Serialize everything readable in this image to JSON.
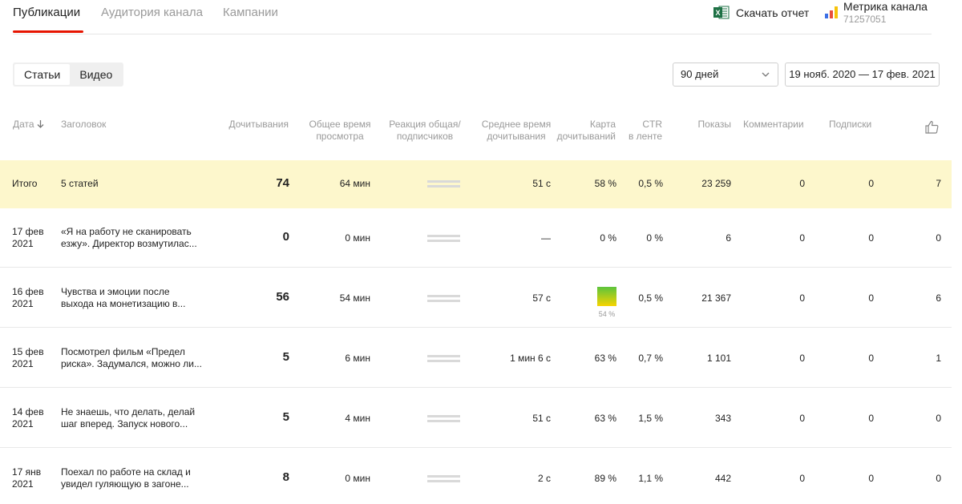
{
  "nav": {
    "tabs": [
      "Публикации",
      "Аудитория канала",
      "Кампании"
    ],
    "download_label": "Скачать отчет",
    "metrika_title": "Метрика канала",
    "metrika_id": "71257051"
  },
  "filters": {
    "segments": [
      "Статьи",
      "Видео"
    ],
    "period": "90 дней",
    "date_range": "19 нояб. 2020 — 17 фев. 2021"
  },
  "table": {
    "headers": {
      "date": "Дата",
      "title": "Заголовок",
      "reads": "Дочитывания",
      "total_time": [
        "Общее время",
        "просмотра"
      ],
      "reaction": [
        "Реакция общая/",
        "подписчиков"
      ],
      "avg_time": [
        "Среднее время",
        "дочитывания"
      ],
      "map": [
        "Карта",
        "дочитываний"
      ],
      "ctr": [
        "CTR",
        "в ленте"
      ],
      "shows": "Показы",
      "comments": "Комментарии",
      "subs": "Подписки"
    },
    "total": {
      "label": "Итого",
      "title": "5 статей",
      "reads": "74",
      "total_time": "64 мин",
      "avg_time": "51 с",
      "map": "58 %",
      "ctr": "0,5 %",
      "shows": "23 259",
      "comments": "0",
      "subs": "0",
      "likes": "7"
    },
    "rows": [
      {
        "date": [
          "17 фев",
          "2021"
        ],
        "title": [
          "«Я на работу не сканировать",
          "езжу». Директор возмутилас..."
        ],
        "reads": "0",
        "total_time": "0 мин",
        "avg_time": "—",
        "map": "0 %",
        "ctr": "0 %",
        "shows": "6",
        "comments": "0",
        "subs": "0",
        "likes": "0"
      },
      {
        "date": [
          "16 фев",
          "2021"
        ],
        "title": [
          "Чувства и эмоции после",
          "выхода на монетизацию в..."
        ],
        "reads": "56",
        "total_time": "54 мин",
        "avg_time": "57 с",
        "map": "54 %",
        "ctr": "0,5 %",
        "shows": "21 367",
        "comments": "0",
        "subs": "0",
        "likes": "6"
      },
      {
        "date": [
          "15 фев",
          "2021"
        ],
        "title": [
          "Посмотрел фильм «Предел",
          "риска». Задумался, можно ли..."
        ],
        "reads": "5",
        "total_time": "6 мин",
        "avg_time": "1 мин 6 с",
        "map": "63 %",
        "ctr": "0,7 %",
        "shows": "1 101",
        "comments": "0",
        "subs": "0",
        "likes": "1"
      },
      {
        "date": [
          "14 фев",
          "2021"
        ],
        "title": [
          "Не знаешь, что делать, делай",
          "шаг вперед. Запуск нового..."
        ],
        "reads": "5",
        "total_time": "4 мин",
        "avg_time": "51 с",
        "map": "63 %",
        "ctr": "1,5 %",
        "shows": "343",
        "comments": "0",
        "subs": "0",
        "likes": "0"
      },
      {
        "date": [
          "17 янв",
          "2021"
        ],
        "title": [
          "Поехал по работе на склад и",
          "увидел гуляющую в загоне..."
        ],
        "reads": "8",
        "total_time": "0 мин",
        "avg_time": "2 с",
        "map": "89 %",
        "ctr": "1,1 %",
        "shows": "442",
        "comments": "0",
        "subs": "0",
        "likes": "0"
      }
    ]
  },
  "colors": {
    "accent": "#e61400",
    "total_row_bg": "#fdf7cc",
    "muted_text": "#9a9a9a"
  }
}
